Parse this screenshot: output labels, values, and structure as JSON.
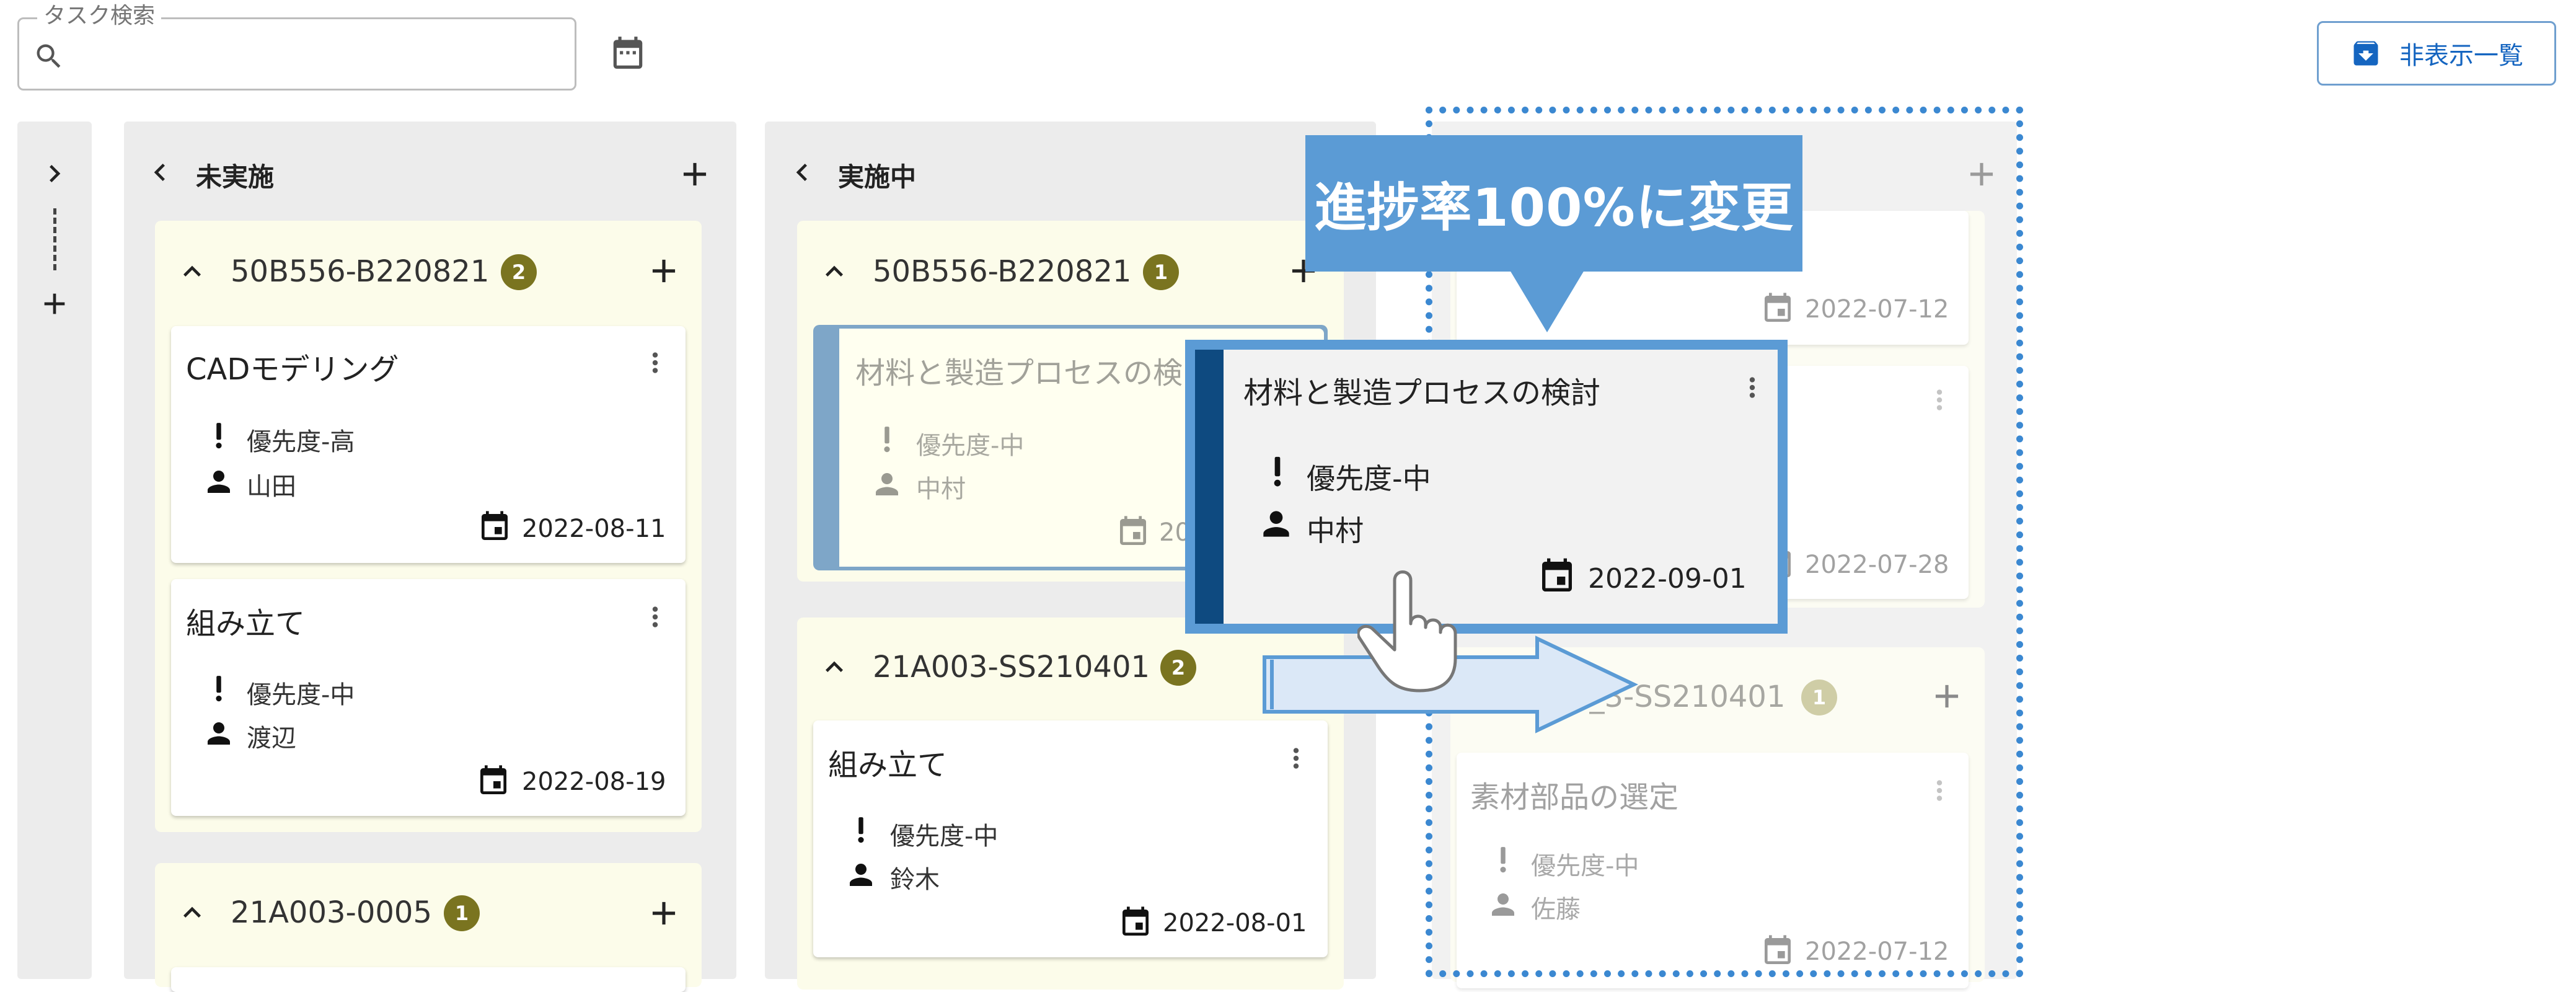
{
  "search": {
    "legend": "タスク検索",
    "placeholder": "",
    "value": ""
  },
  "toolbar": {
    "hidden_list_label": "非表示一覧"
  },
  "columns": [
    {
      "title": "未実施",
      "groups": [
        {
          "name": "50B556-B220821",
          "count": "2",
          "cards": [
            {
              "title": "CADモデリング",
              "priority": "優先度-高",
              "assignee": "山田",
              "date": "2022-08-11"
            },
            {
              "title": "組み立て",
              "priority": "優先度-中",
              "assignee": "渡辺",
              "date": "2022-08-19"
            }
          ]
        },
        {
          "name": "21A003-0005",
          "count": "1"
        }
      ]
    },
    {
      "title": "実施中",
      "groups": [
        {
          "name": "50B556-B220821",
          "count": "1",
          "cards": [
            {
              "title": "材料と製造プロセスの検",
              "priority": "優先度-中",
              "assignee": "中村",
              "date": "20"
            }
          ]
        },
        {
          "name": "21A003-SS210401",
          "count": "2",
          "cards": [
            {
              "title": "組み立て",
              "priority": "優先度-中",
              "assignee": "鈴木",
              "date": "2022-08-01"
            }
          ]
        }
      ]
    },
    {
      "title": "",
      "groups": [
        {
          "cards": [
            {
              "date": "2022-07-12"
            },
            {
              "date": "2022-07-28"
            }
          ]
        },
        {
          "name": "21A0_3-SS210401",
          "count": "1",
          "cards": [
            {
              "title": "素材部品の選定",
              "priority": "優先度-中",
              "assignee": "佐藤",
              "date": "2022-07-12"
            }
          ]
        }
      ]
    }
  ],
  "overlay": {
    "callout_text": "進捗率100%に変更",
    "drag_card": {
      "title": "材料と製造プロセスの検討",
      "priority": "優先度-中",
      "assignee": "中村",
      "date": "2022-09-01"
    }
  },
  "icons": [
    "search-icon",
    "calendar-icon",
    "archive-icon",
    "chevron-right-icon",
    "chevron-left-icon",
    "chevron-up-icon",
    "plus-icon",
    "more-vert-icon",
    "priority-icon",
    "person-icon",
    "event-icon",
    "hand-pointer-icon",
    "arrow-right-icon"
  ],
  "colors": {
    "accent": "#1565c0",
    "badge": "#7a7420",
    "group_bg": "#fcfcea",
    "callout": "#5b9bd5",
    "drop_border": "#3b88d1",
    "drag_stripe": "#0e4a80"
  }
}
